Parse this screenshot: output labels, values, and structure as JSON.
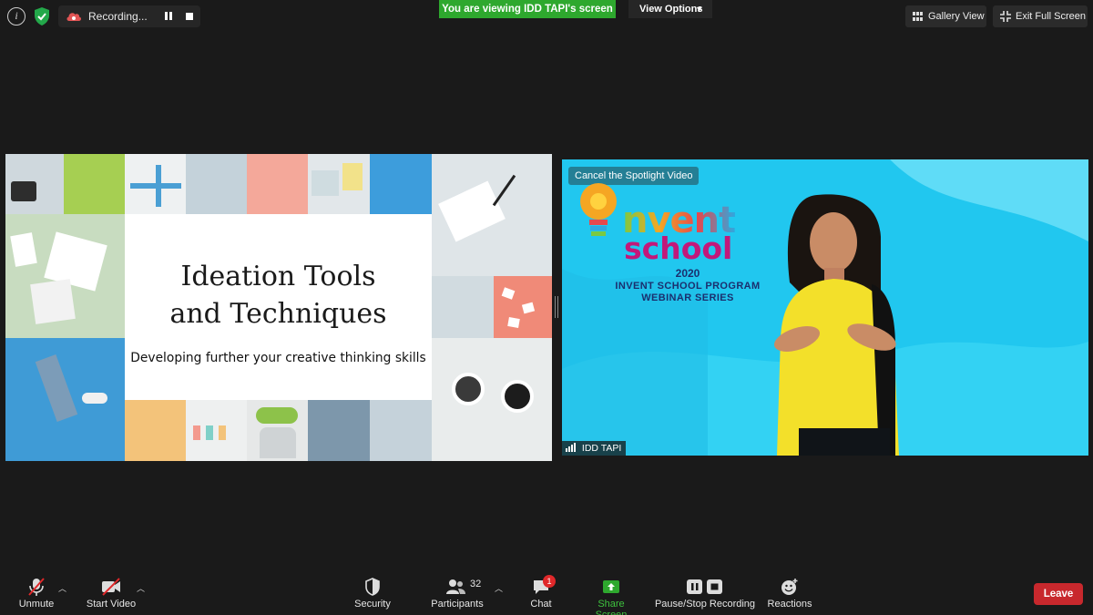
{
  "topbar": {
    "recording_label": "Recording...",
    "viewing_banner": "You are viewing IDD TAPI's screen",
    "view_options_label": "View Options",
    "gallery_view_label": "Gallery View",
    "exit_fullscreen_label": "Exit Full Screen"
  },
  "slide": {
    "title_line1": "Ideation Tools",
    "title_line2": "and Techniques",
    "subtitle": "Developing further your creative thinking skills"
  },
  "video": {
    "cancel_spotlight_label": "Cancel the Spotlight Video",
    "brand_invent": "nvent",
    "brand_school": "school",
    "brand_year": "2020",
    "brand_line1": "INVENT SCHOOL PROGRAM",
    "brand_line2": "WEBINAR SERIES",
    "participant_name": "IDD TAPI"
  },
  "toolbar": {
    "unmute_label": "Unmute",
    "start_video_label": "Start Video",
    "security_label": "Security",
    "participants_label": "Participants",
    "participants_count": "32",
    "chat_label": "Chat",
    "chat_badge": "1",
    "share_screen_label": "Share Screen",
    "pause_stop_recording_label": "Pause/Stop Recording",
    "reactions_label": "Reactions",
    "leave_label": "Leave"
  },
  "colors": {
    "background": "#1a1a1a",
    "viewing_banner": "#2ea82e",
    "leave": "#c8282d",
    "video_bg": "#21c7ef",
    "share_green": "#2ea82e"
  }
}
